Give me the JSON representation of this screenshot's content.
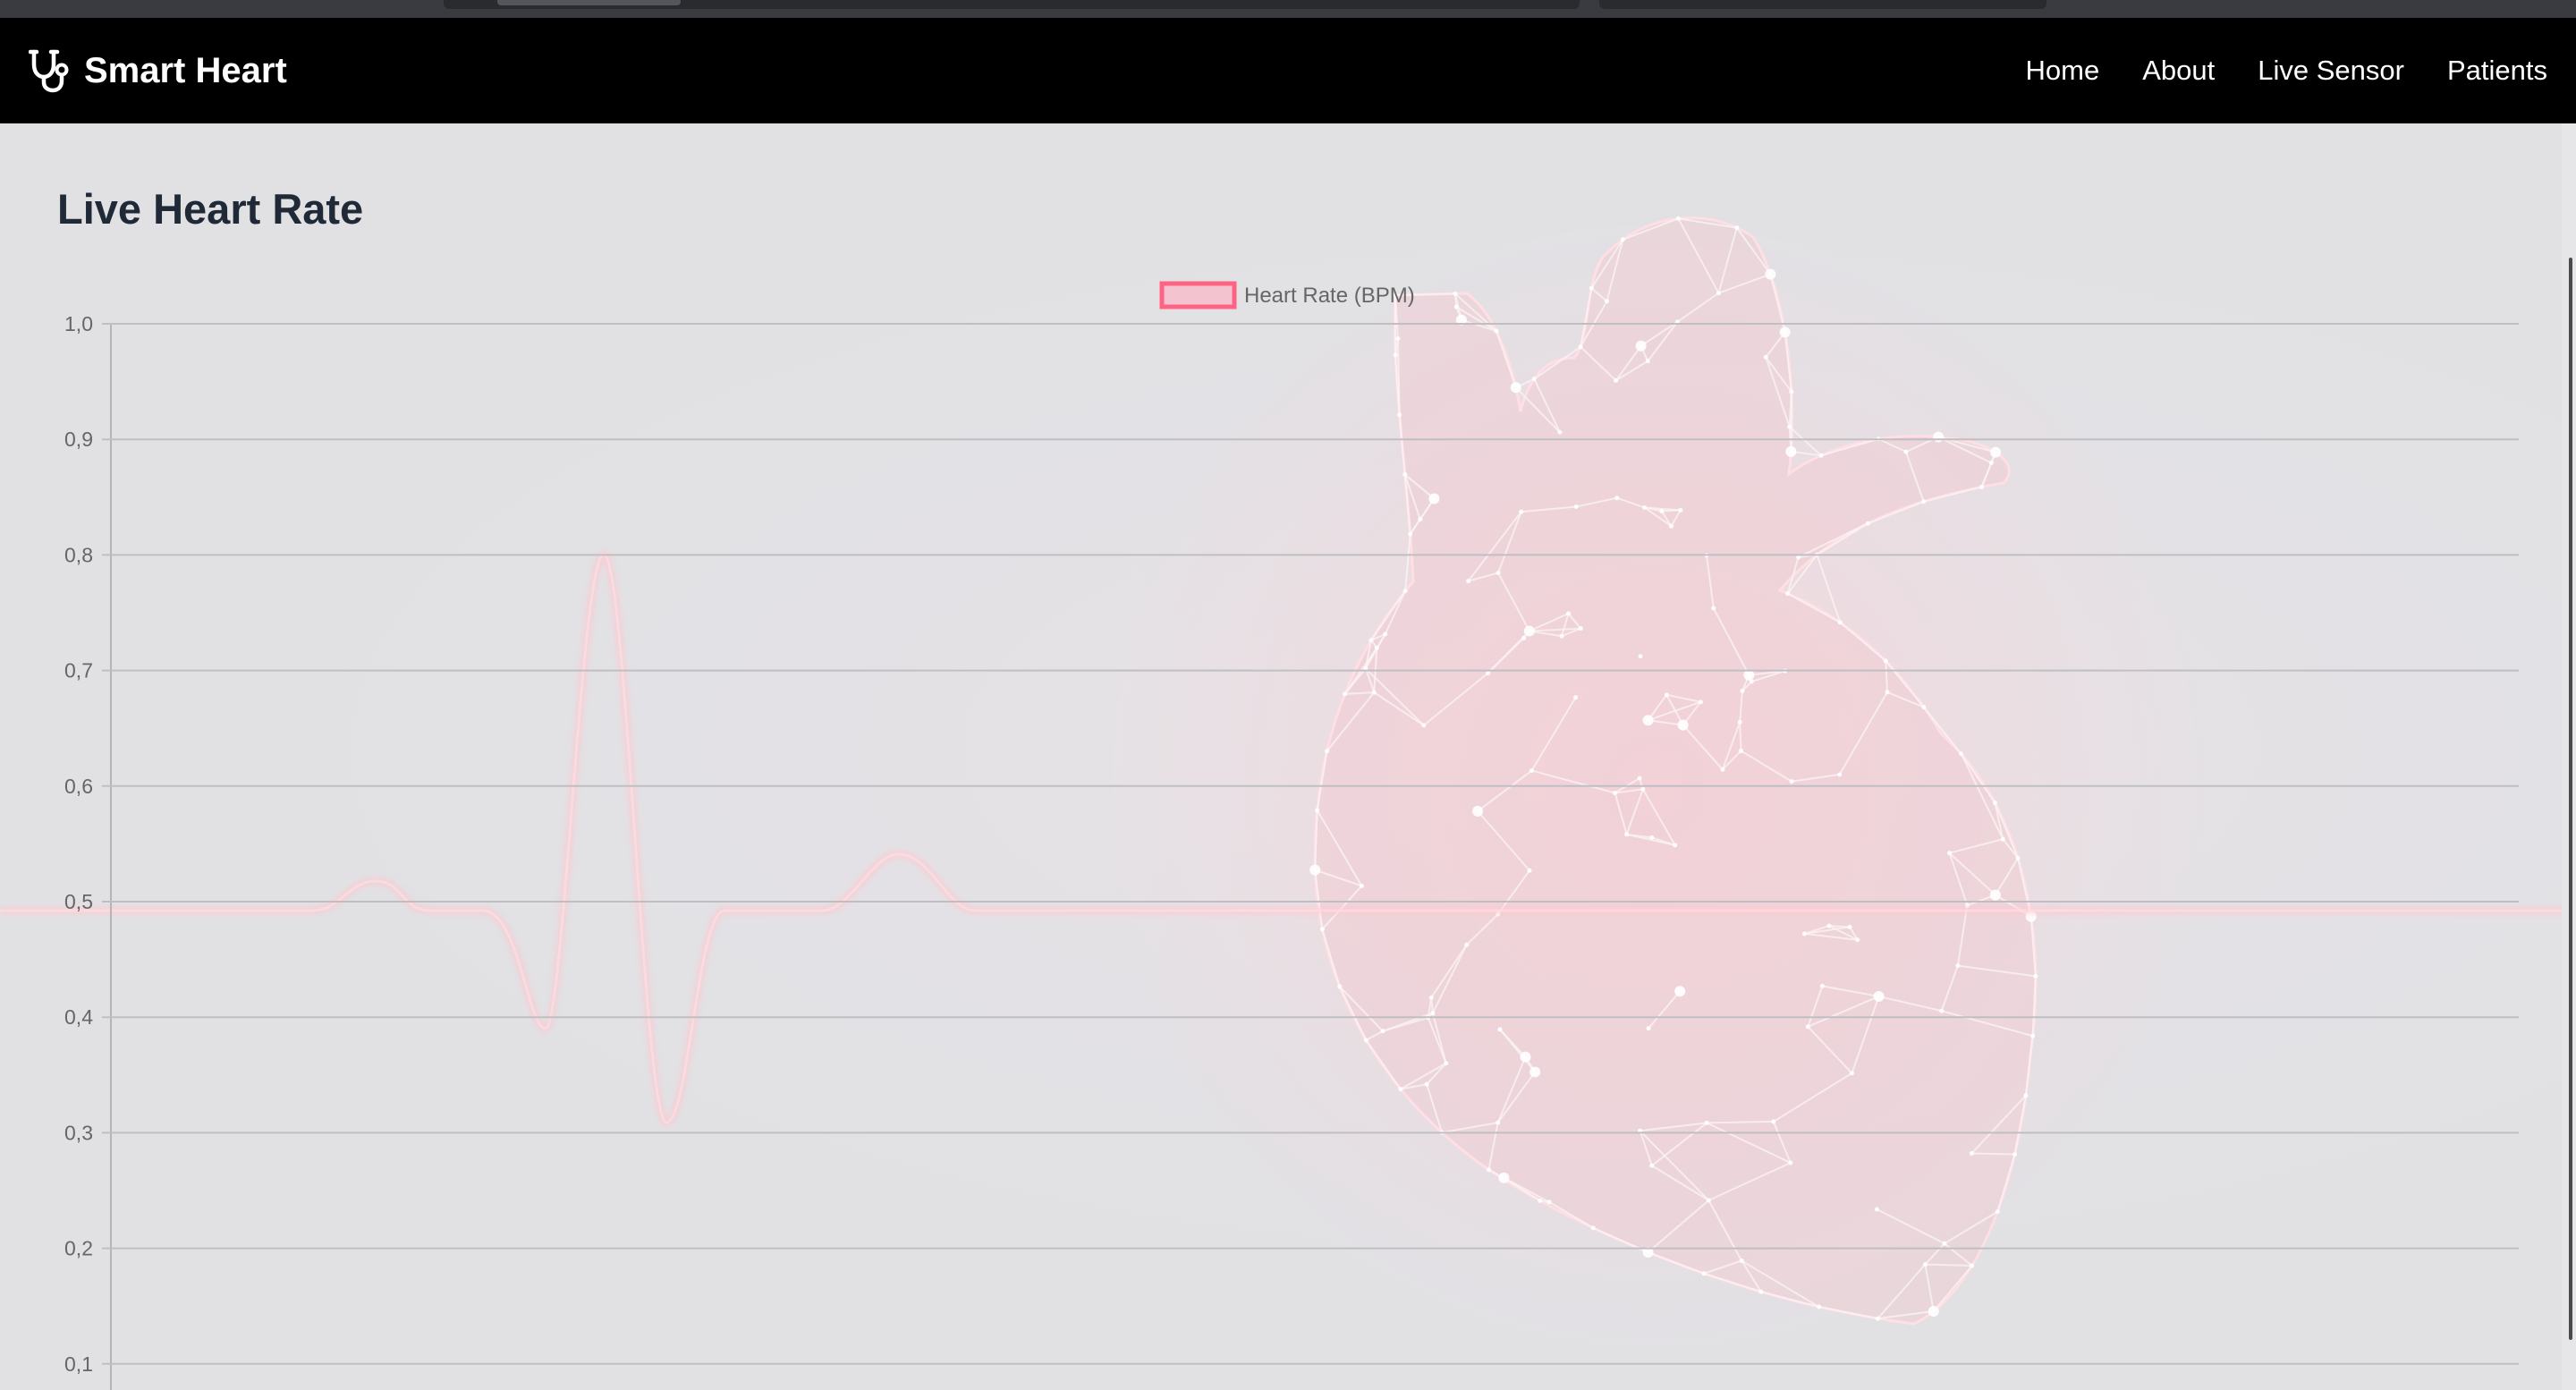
{
  "navbar": {
    "brand": "Smart Heart",
    "brand_icon": "stethoscope-icon",
    "links": [
      "Home",
      "About",
      "Live Sensor",
      "Patients"
    ]
  },
  "page": {
    "title": "Live Heart Rate"
  },
  "chart_data": {
    "type": "line",
    "legend": [
      "Heart Rate (BPM)"
    ],
    "legend_placement": "top-center",
    "series": [
      {
        "name": "Heart Rate (BPM)",
        "values": [],
        "border_color": "#ff6384",
        "fill_color": "#ffb1c1"
      }
    ],
    "yticks": [
      "1,0",
      "0,9",
      "0,8",
      "0,7",
      "0,6",
      "0,5",
      "0,4",
      "0,3",
      "0,2",
      "0,1"
    ],
    "ylim": [
      0,
      1.0
    ],
    "grid": true
  },
  "background": {
    "decoration": "polygonal-heart-and-ecg-illustration",
    "accent_color": "#ff9aa8"
  }
}
